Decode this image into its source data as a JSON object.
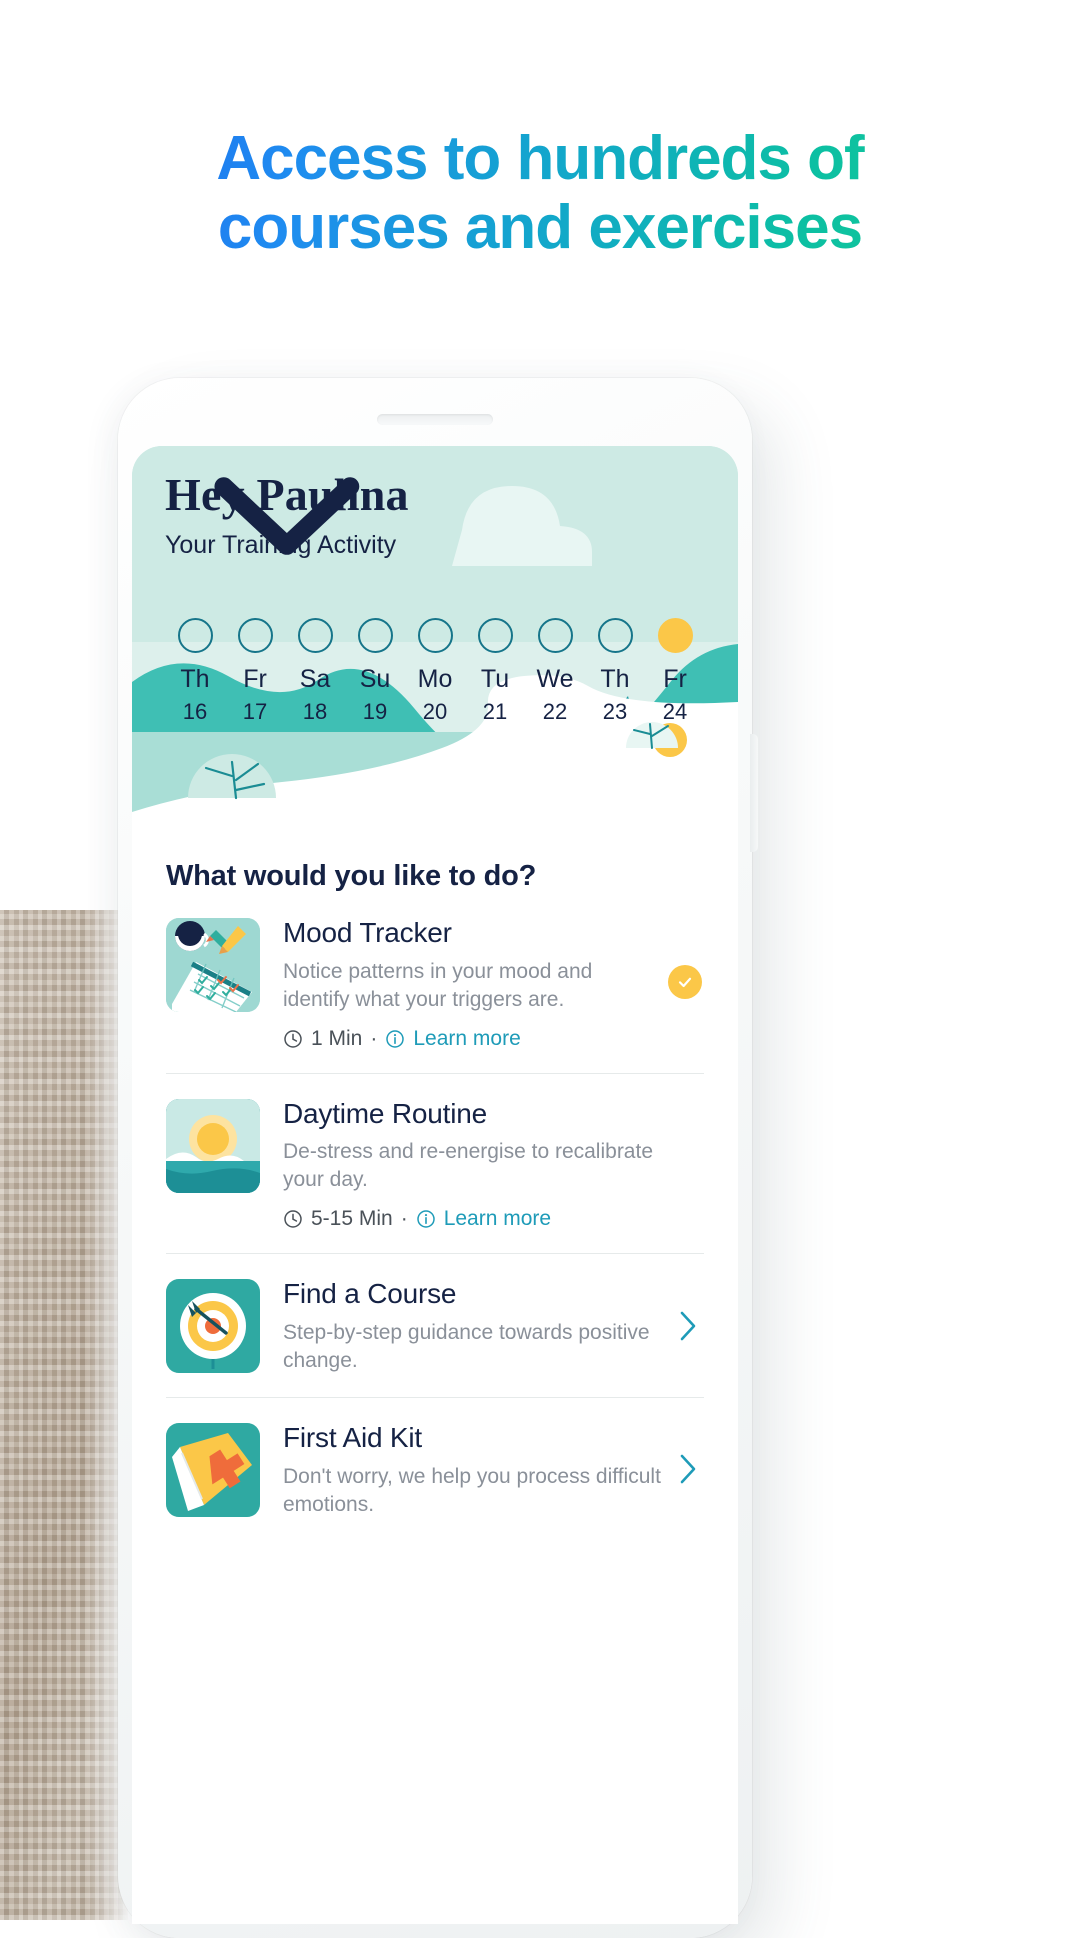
{
  "headline": {
    "line1": "Access to hundreds of",
    "line2": "courses and exercises",
    "gradient_start": "#1f5cf0",
    "gradient_end": "#18cf8e"
  },
  "app": {
    "greeting": "Hey Paulina",
    "subtitle": "Your Training Activity",
    "subtitle_icon": "chevron-down-icon",
    "hero_bg": "#cdeae4",
    "accent_yellow": "#fbc748",
    "accent_teal": "#3fbfb4",
    "text_navy": "#152244"
  },
  "week": {
    "days": [
      {
        "weekday": "Th",
        "date": "16",
        "state": "empty"
      },
      {
        "weekday": "Fr",
        "date": "17",
        "state": "empty"
      },
      {
        "weekday": "Sa",
        "date": "18",
        "state": "empty"
      },
      {
        "weekday": "Su",
        "date": "19",
        "state": "empty"
      },
      {
        "weekday": "Mo",
        "date": "20",
        "state": "empty"
      },
      {
        "weekday": "Tu",
        "date": "21",
        "state": "empty"
      },
      {
        "weekday": "We",
        "date": "22",
        "state": "empty"
      },
      {
        "weekday": "Th",
        "date": "23",
        "state": "empty"
      },
      {
        "weekday": "Fr",
        "date": "24",
        "state": "filled"
      }
    ]
  },
  "list": {
    "title": "What would you like to do?",
    "items": [
      {
        "title": "Mood Tracker",
        "desc": "Notice patterns in your mood and identify what your triggers are.",
        "duration": "1 Min",
        "separator": "·",
        "learn_more": "Learn more",
        "clock_icon": "clock-icon",
        "info_icon": "info-icon",
        "thumb": "mood-tracker-thumb",
        "trailing": "check-badge"
      },
      {
        "title": "Daytime Routine",
        "desc": "De-stress and re-energise to recalibrate your day.",
        "duration": "5-15 Min",
        "separator": "·",
        "learn_more": "Learn more",
        "clock_icon": "clock-icon",
        "info_icon": "info-icon",
        "thumb": "daytime-routine-thumb",
        "trailing": "none"
      },
      {
        "title": "Find a Course",
        "desc": "Step-by-step guidance towards positive change.",
        "duration": "",
        "separator": "",
        "learn_more": "",
        "clock_icon": "",
        "info_icon": "",
        "thumb": "find-a-course-thumb",
        "trailing": "chevron-right"
      },
      {
        "title": "First Aid Kit",
        "desc": "Don't worry, we help you process difficult emotions.",
        "duration": "",
        "separator": "",
        "learn_more": "",
        "clock_icon": "",
        "info_icon": "",
        "thumb": "first-aid-kit-thumb",
        "trailing": "chevron-right"
      }
    ]
  }
}
